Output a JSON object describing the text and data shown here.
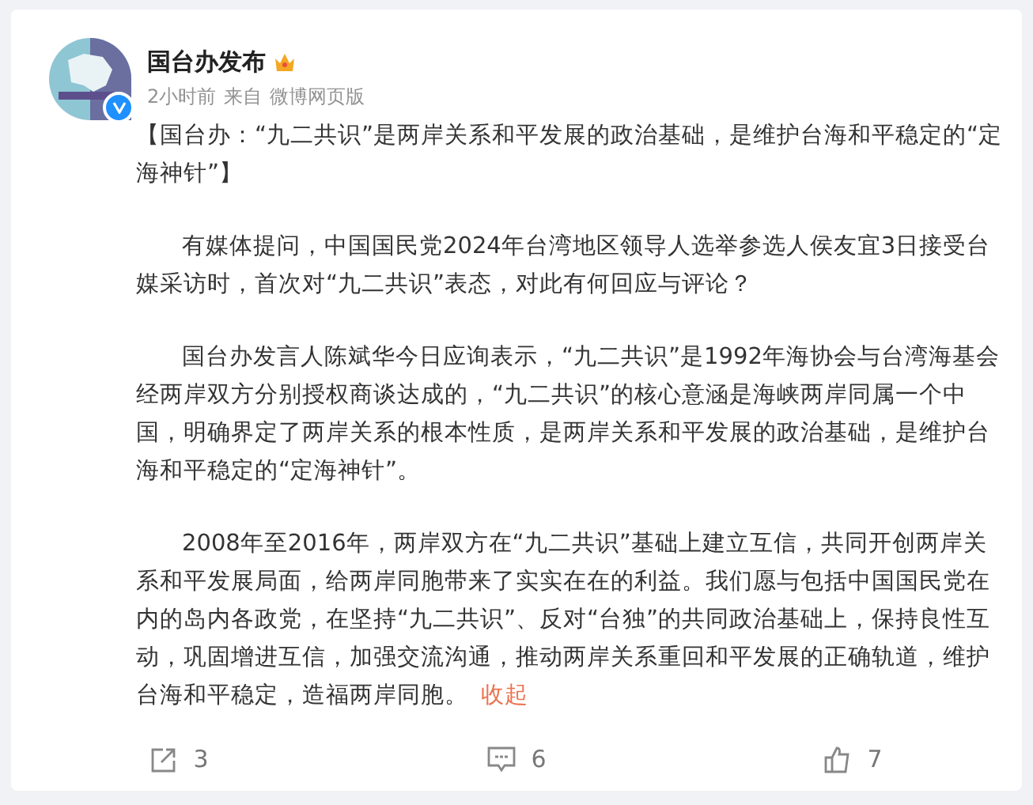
{
  "author": {
    "name": "国台办发布",
    "time": "2小时前",
    "source_prefix": "来自",
    "source": "微博网页版",
    "verified": true
  },
  "post": {
    "title": "【国台办：“九二共识”是两岸关系和平发展的政治基础，是维护台海和平稳定的“定海神针”】",
    "paragraphs": [
      "有媒体提问，中国国民党2024年台湾地区领导人选举参选人侯友宜3日接受台媒采访时，首次对“九二共识”表态，对此有何回应与评论？",
      "国台办发言人陈斌华今日应询表示，“九二共识”是1992年海协会与台湾海基会经两岸双方分别授权商谈达成的，“九二共识”的核心意涵是海峡两岸同属一个中国，明确界定了两岸关系的根本性质，是两岸关系和平发展的政治基础，是维护台海和平稳定的“定海神针”。",
      "2008年至2016年，两岸双方在“九二共识”基础上建立互信，共同开创两岸关系和平发展局面，给两岸同胞带来了实实在在的利益。我们愿与包括中国国民党在内的岛内各政党，在坚持“九二共识”、反对“台独”的共同政治基础上，保持良性互动，巩固增进互信，加强交流沟通，推动两岸关系重回和平发展的正确轨道，维护台海和平稳定，造福两岸同胞。"
    ],
    "collapse_link": "收起"
  },
  "actions": [
    {
      "kind": "share",
      "count": "3"
    },
    {
      "kind": "comment",
      "count": "6"
    },
    {
      "kind": "like",
      "count": "7"
    }
  ]
}
